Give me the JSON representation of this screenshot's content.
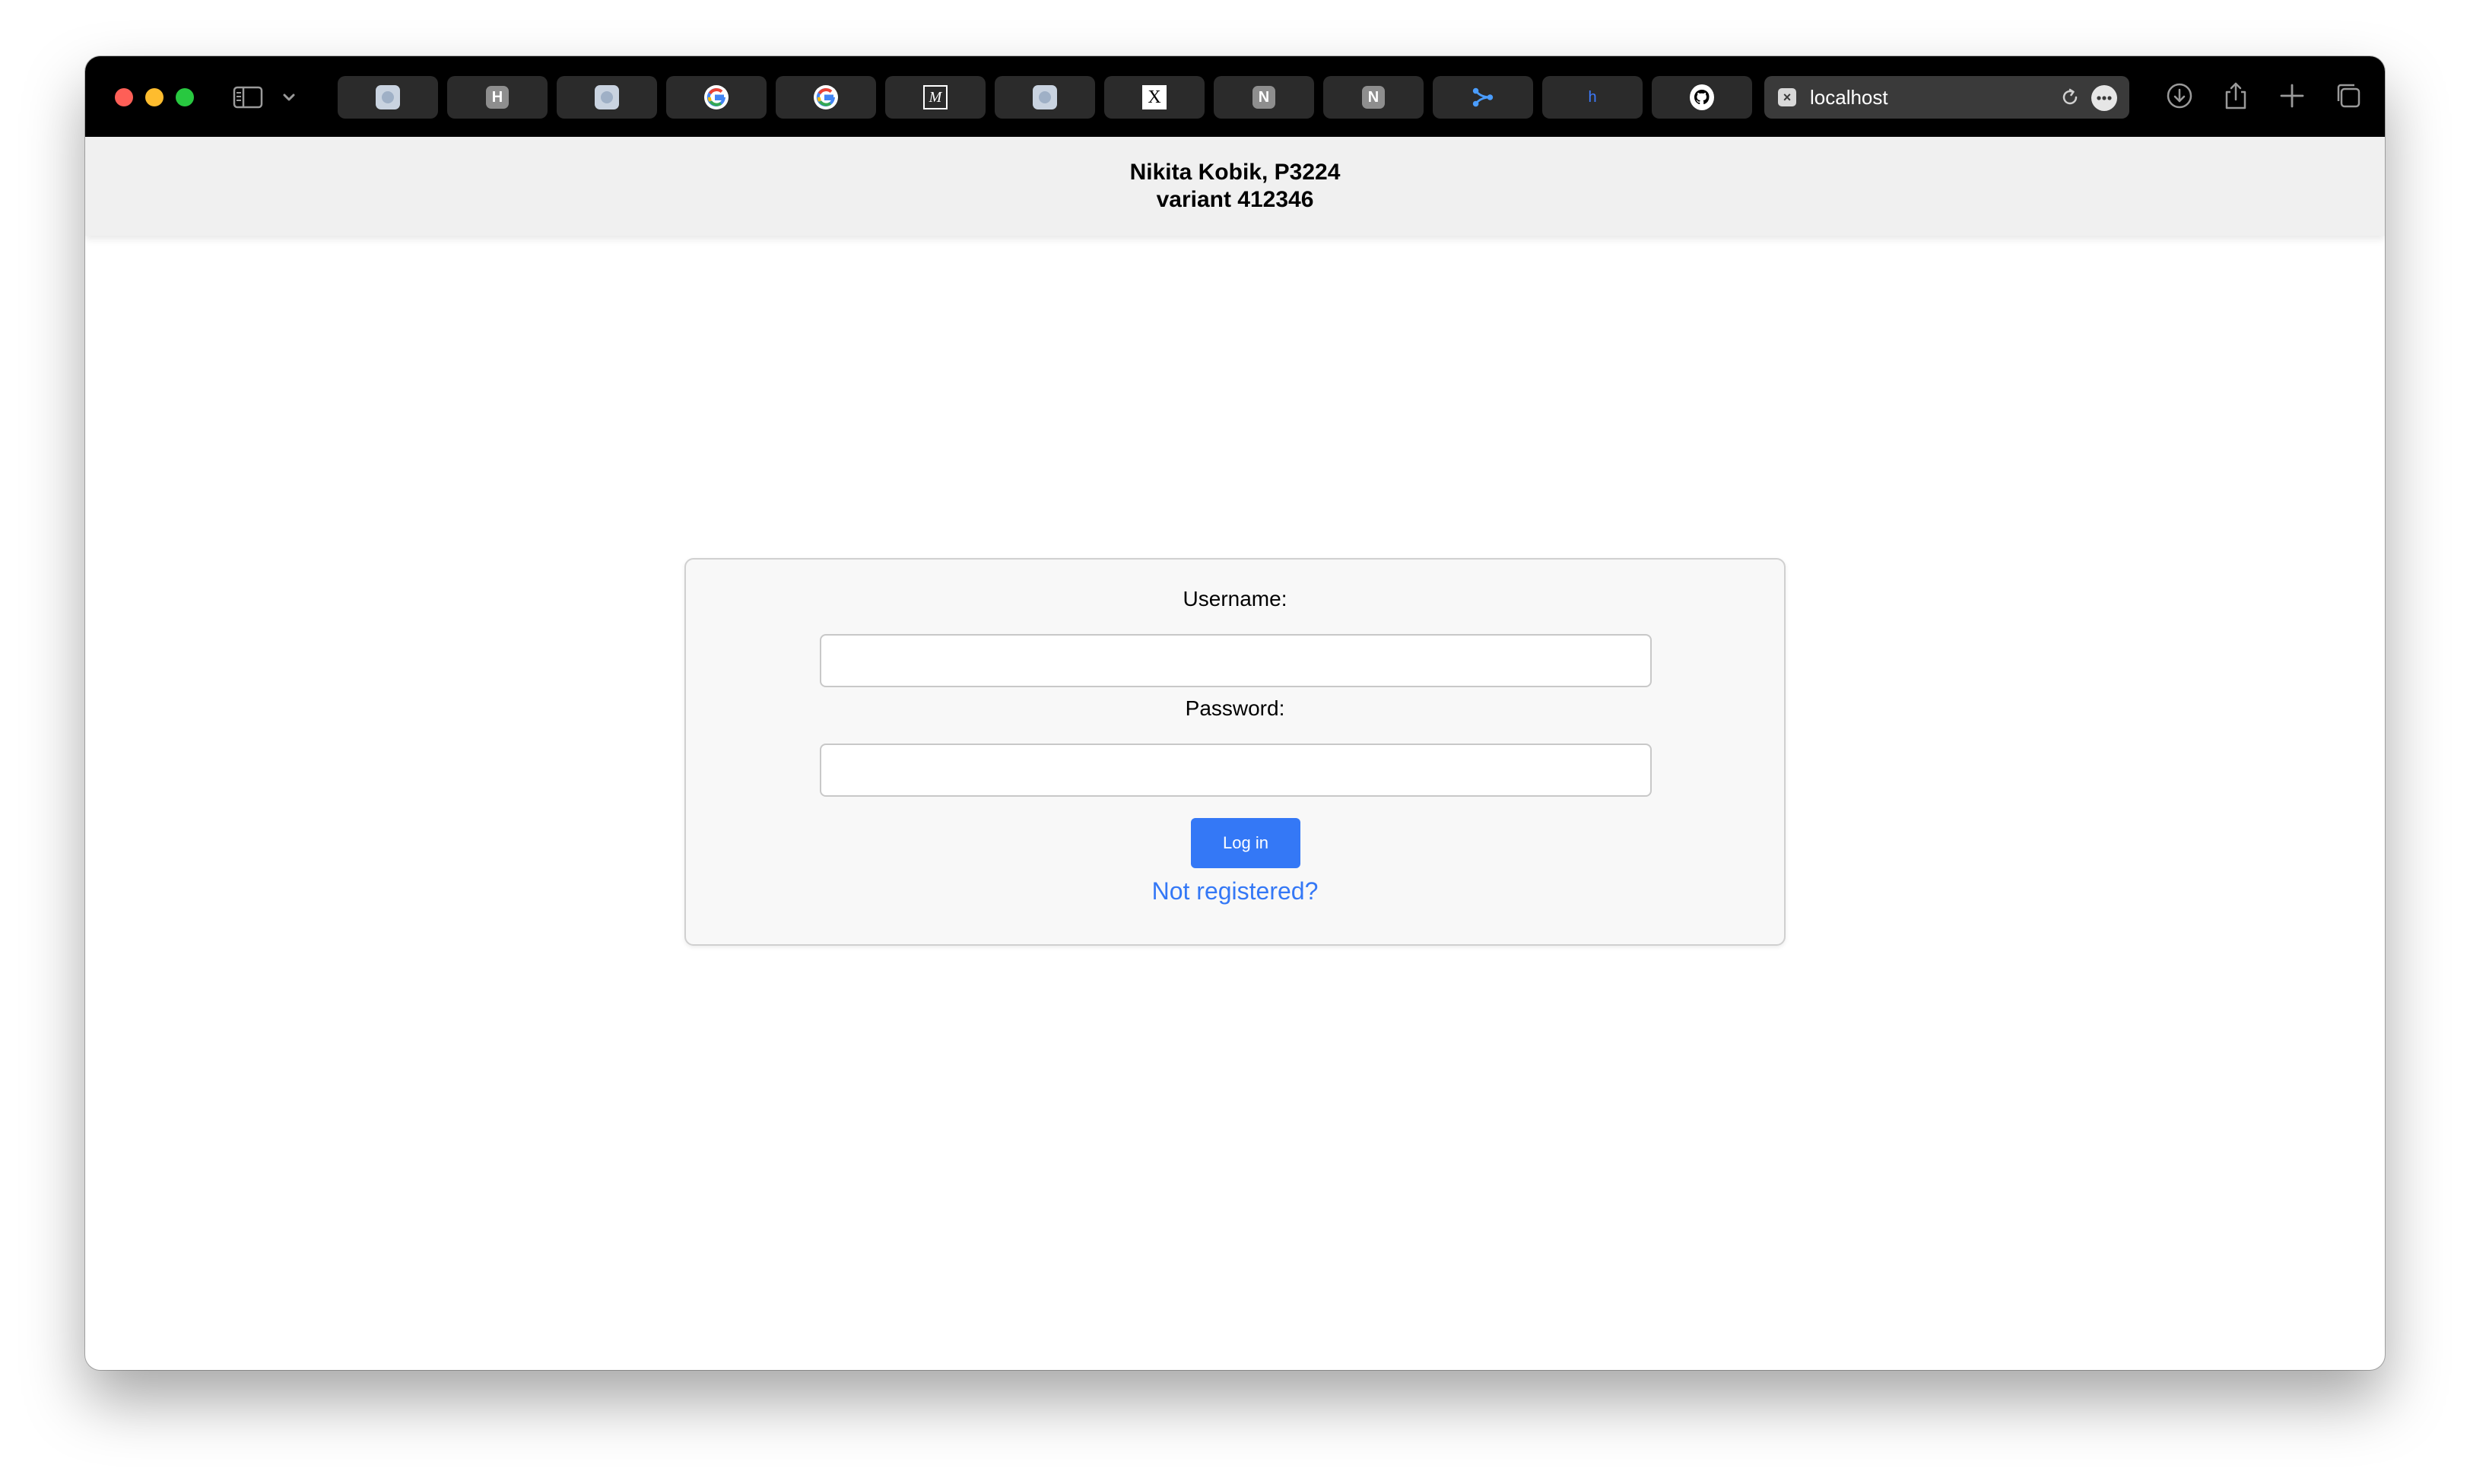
{
  "browser": {
    "tabs": [
      {
        "icon": "app-blob-icon"
      },
      {
        "icon": "h-letter-icon",
        "letter": "H"
      },
      {
        "icon": "app-blob-icon"
      },
      {
        "icon": "google-icon"
      },
      {
        "icon": "google-icon"
      },
      {
        "icon": "medium-icon"
      },
      {
        "icon": "app-blob-icon"
      },
      {
        "icon": "x-icon"
      },
      {
        "icon": "notion-icon",
        "letter": "N"
      },
      {
        "icon": "notion-icon",
        "letter": "N"
      },
      {
        "icon": "share-nodes-icon"
      },
      {
        "icon": "h-small-icon",
        "letter": "h"
      },
      {
        "icon": "github-icon"
      }
    ],
    "address": "localhost",
    "colors": {
      "titlebar": "#000000",
      "tab": "#2b2b2b",
      "address_bg": "#3a3a3a"
    }
  },
  "header": {
    "line1": "Nikita Kobik, P3224",
    "line2": "variant 412346"
  },
  "login": {
    "username_label": "Username:",
    "username_value": "",
    "password_label": "Password:",
    "password_value": "",
    "submit_label": "Log in",
    "register_link": "Not registered?"
  },
  "colors": {
    "accent": "#3478f6",
    "header_bg": "#f0f0f0",
    "card_bg": "#f8f8f8"
  }
}
